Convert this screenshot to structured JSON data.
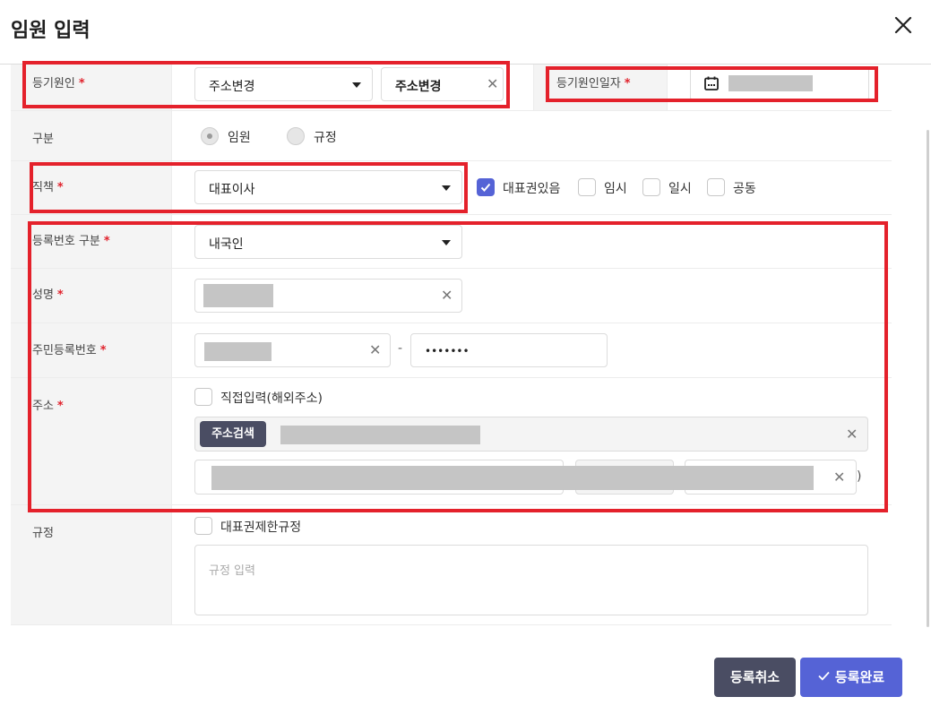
{
  "dialog": {
    "title": "임원 입력"
  },
  "rows": {
    "reason": {
      "label": "등기원인",
      "required": "*",
      "select_value": "주소변경",
      "text_value": "주소변경"
    },
    "reason_date": {
      "label": "등기원인일자",
      "required": "*"
    },
    "type": {
      "label": "구분",
      "options": [
        "임원",
        "규정"
      ],
      "selected": "임원"
    },
    "position": {
      "label": "직책",
      "required": "*",
      "select_value": "대표이사",
      "checkboxes": [
        {
          "label": "대표권있음",
          "checked": true
        },
        {
          "label": "임시",
          "checked": false
        },
        {
          "label": "일시",
          "checked": false
        },
        {
          "label": "공동",
          "checked": false
        }
      ]
    },
    "reg_type": {
      "label": "등록번호 구분",
      "required": "*",
      "select_value": "내국인"
    },
    "name": {
      "label": "성명",
      "required": "*"
    },
    "rrn": {
      "label": "주민등록번호",
      "required": "*",
      "separator": "-",
      "back_masked": "•••••••"
    },
    "address": {
      "label": "주소",
      "required": "*",
      "direct_input_label": "직접입력(해외주소)",
      "search_button": "주소검색",
      "suffix": ")"
    },
    "rule": {
      "label": "규정",
      "checkbox_label": "대표권제한규정",
      "placeholder": "규정 입력"
    }
  },
  "footer": {
    "cancel_label": "등록취소",
    "submit_label": "등록완료"
  },
  "colors": {
    "accent": "#5563d6",
    "dark_button": "#4a4d63",
    "highlight": "#e4212b"
  },
  "icons": {
    "close": "close-icon",
    "calendar": "calendar-icon",
    "check": "check-icon"
  }
}
